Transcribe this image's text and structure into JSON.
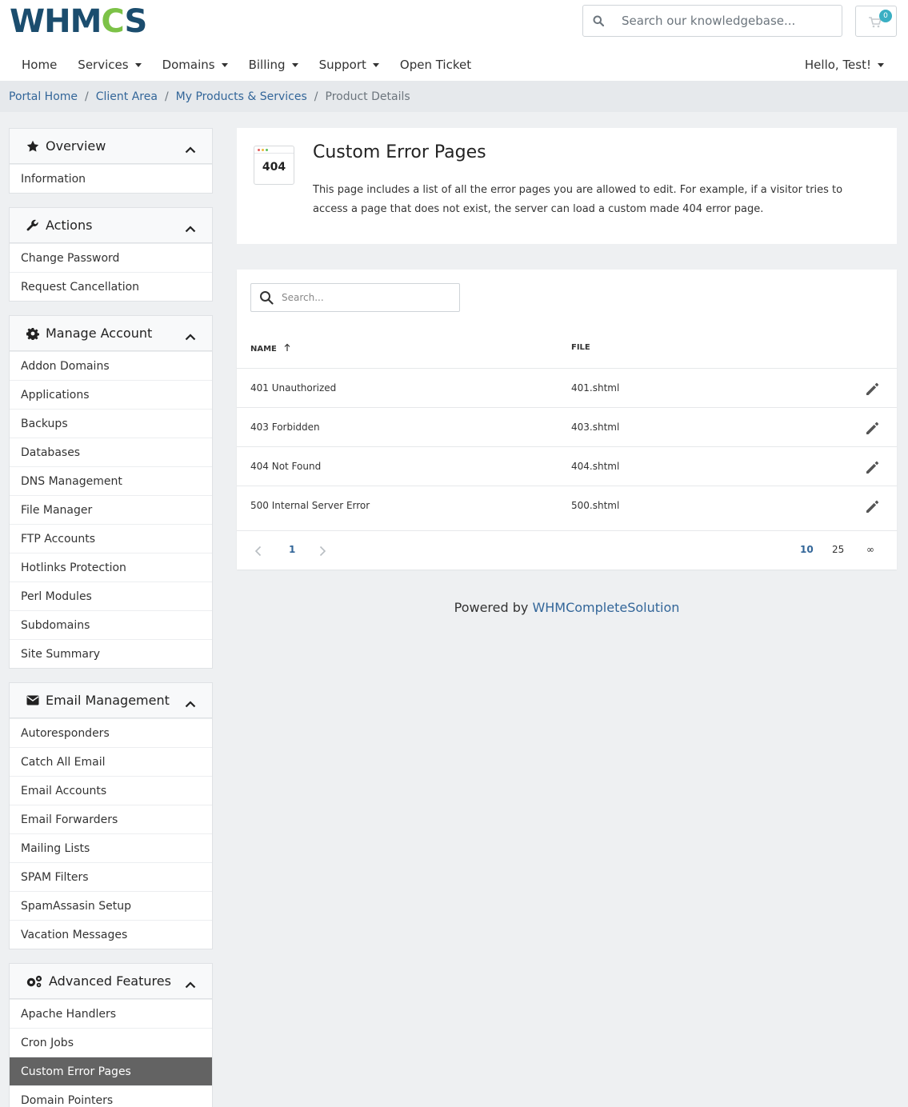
{
  "header": {
    "logo_text_pre": "WHM",
    "logo_text_gear": "C",
    "logo_text_post": "S",
    "search_placeholder": "Search our knowledgebase...",
    "cart_count": "0"
  },
  "nav": {
    "home": "Home",
    "services": "Services",
    "domains": "Domains",
    "billing": "Billing",
    "support": "Support",
    "open_ticket": "Open Ticket",
    "user": "Hello, Test!"
  },
  "breadcrumb": {
    "portal_home": "Portal Home",
    "client_area": "Client Area",
    "products": "My Products & Services",
    "current": "Product Details"
  },
  "sidebar": {
    "overview": {
      "title": "Overview",
      "items": [
        "Information"
      ]
    },
    "actions": {
      "title": "Actions",
      "items": [
        "Change Password",
        "Request Cancellation"
      ]
    },
    "manage": {
      "title": "Manage Account",
      "items": [
        "Addon Domains",
        "Applications",
        "Backups",
        "Databases",
        "DNS Management",
        "File Manager",
        "FTP Accounts",
        "Hotlinks Protection",
        "Perl Modules",
        "Subdomains",
        "Site Summary"
      ]
    },
    "email": {
      "title": "Email Management",
      "items": [
        "Autoresponders",
        "Catch All Email",
        "Email Accounts",
        "Email Forwarders",
        "Mailing Lists",
        "SPAM Filters",
        "SpamAssasin Setup",
        "Vacation Messages"
      ]
    },
    "advanced": {
      "title": "Advanced Features",
      "items": [
        "Apache Handlers",
        "Cron Jobs",
        "Custom Error Pages",
        "Domain Pointers"
      ]
    }
  },
  "intro": {
    "thumb_code": "404",
    "title": "Custom Error Pages",
    "description": "This page includes a list of all the error pages you are allowed to edit. For example, if a visitor tries to access a page that does not exist, the server can load a custom made 404 error page."
  },
  "table": {
    "search_placeholder": "Search...",
    "col_name": "NAME",
    "col_file": "FILE",
    "rows": [
      {
        "name": "401 Unauthorized",
        "file": "401.shtml"
      },
      {
        "name": "403 Forbidden",
        "file": "403.shtml"
      },
      {
        "name": "404 Not Found",
        "file": "404.shtml"
      },
      {
        "name": "500 Internal Server Error",
        "file": "500.shtml"
      }
    ],
    "page": "1",
    "sizes": [
      "10",
      "25",
      "∞"
    ]
  },
  "footer": {
    "powered_by": "Powered by",
    "link": "WHMCompleteSolution"
  },
  "colors": {
    "brand_blue": "#1b4d6e",
    "brand_green": "#7cc247",
    "link": "#336699",
    "active_item_bg": "#636363",
    "cart_badge": "#3aafc3"
  }
}
